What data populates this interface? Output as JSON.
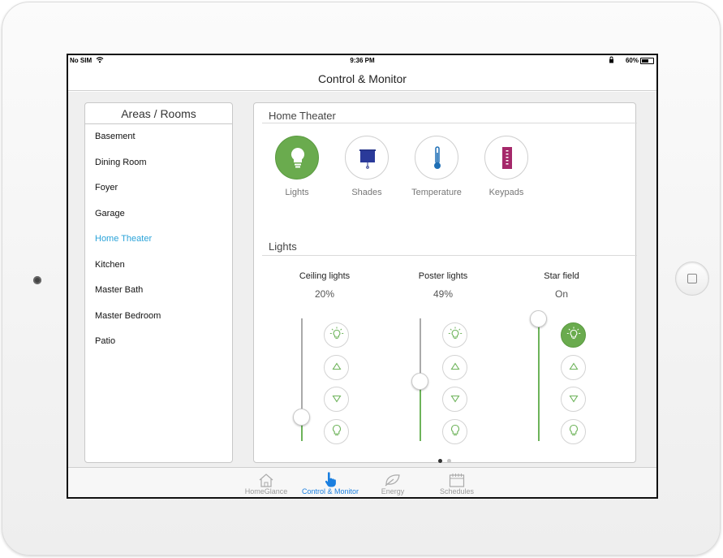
{
  "status": {
    "carrier": "No SIM",
    "time": "9:36 PM",
    "battery": "60%"
  },
  "nav": {
    "title": "Control & Monitor"
  },
  "sidebar": {
    "title": "Areas / Rooms",
    "items": [
      {
        "label": "Basement"
      },
      {
        "label": "Dining Room"
      },
      {
        "label": "Foyer"
      },
      {
        "label": "Garage"
      },
      {
        "label": "Home Theater",
        "active": true
      },
      {
        "label": "Kitchen"
      },
      {
        "label": "Master Bath"
      },
      {
        "label": "Master Bedroom"
      },
      {
        "label": "Patio"
      }
    ]
  },
  "panel": {
    "title": "Home Theater",
    "categories": [
      {
        "label": "Lights",
        "icon": "bulb-icon",
        "active": true
      },
      {
        "label": "Shades",
        "icon": "shades-icon"
      },
      {
        "label": "Temperature",
        "icon": "thermometer-icon"
      },
      {
        "label": "Keypads",
        "icon": "keypad-icon"
      }
    ],
    "section_title": "Lights",
    "lights": [
      {
        "name": "Ceiling lights",
        "value": "20%",
        "level": 0.2,
        "on_active": false
      },
      {
        "name": "Poster lights",
        "value": "49%",
        "level": 0.49,
        "on_active": false
      },
      {
        "name": "Star field",
        "value": "On",
        "level": 1.0,
        "on_active": true
      }
    ],
    "page_dots": 2,
    "page_active": 0
  },
  "tabs": [
    {
      "label": "HomeGlance",
      "icon": "home-icon"
    },
    {
      "label": "Control & Monitor",
      "icon": "hand-pointer-icon",
      "active": true
    },
    {
      "label": "Energy",
      "icon": "energy-icon"
    },
    {
      "label": "Schedules",
      "icon": "calendar-icon"
    }
  ],
  "colors": {
    "accent_green": "#6aab4e",
    "active_blue": "#2aa3d9",
    "tab_blue": "#1a7fe0"
  }
}
